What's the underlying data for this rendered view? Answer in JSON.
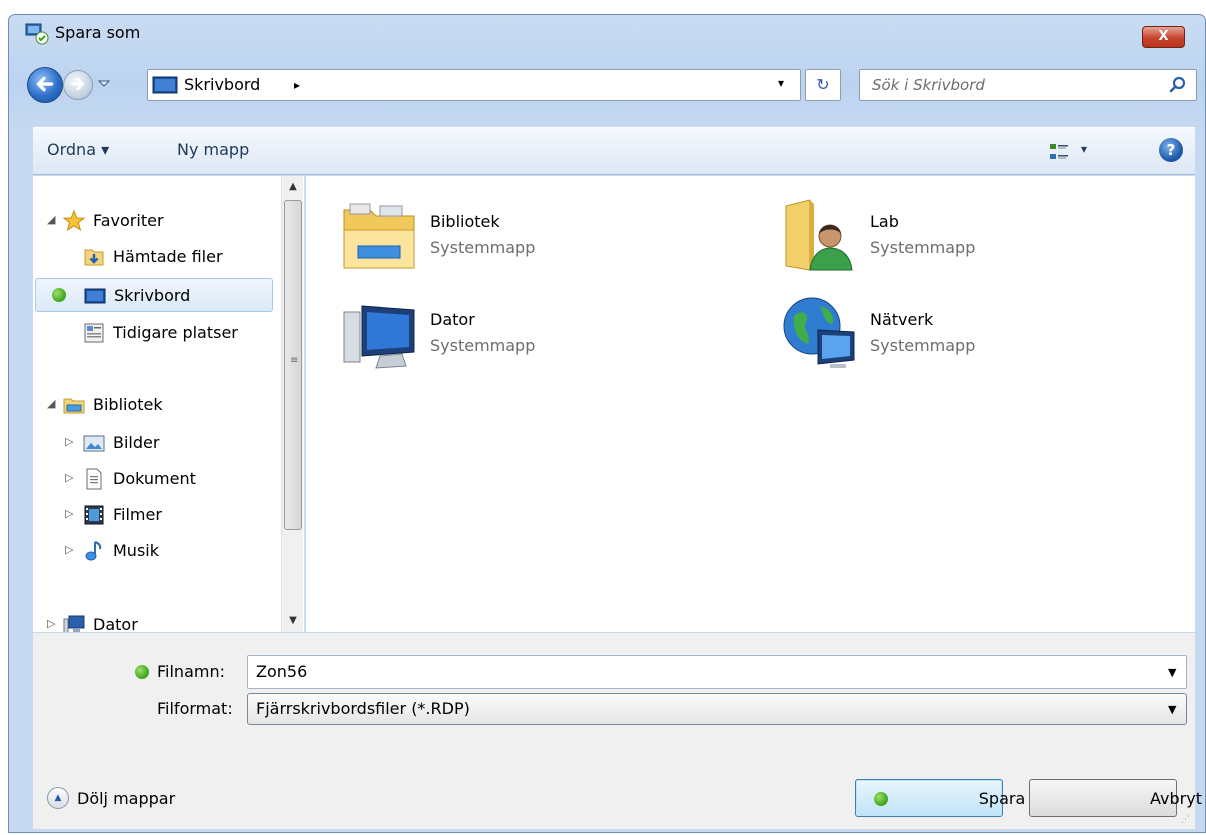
{
  "window": {
    "title": "Spara som",
    "close_label": "X"
  },
  "address": {
    "location": "Skrivbord",
    "breadcrumb_arrow": "▸",
    "dropdown_glyph": "▾",
    "refresh_glyph": "↻",
    "search_placeholder": "Sök i Skrivbord"
  },
  "toolbar": {
    "organize_label": "Ordna ▾",
    "new_folder_label": "Ny mapp",
    "view_dropdown_glyph": "▾",
    "help_glyph": "?"
  },
  "nav": {
    "favorites": {
      "label": "Favoriter",
      "items": [
        "Hämtade filer",
        "Skrivbord",
        "Tidigare platser"
      ],
      "selected": "Skrivbord"
    },
    "libraries": {
      "label": "Bibliotek",
      "items": [
        "Bilder",
        "Dokument",
        "Filmer",
        "Musik"
      ]
    },
    "computer": {
      "label": "Dator"
    },
    "expand_glyph": "◢",
    "collapsed_glyph": "▷",
    "scroll_up": "▲",
    "scroll_down": "▼",
    "grip": "≡"
  },
  "content": {
    "items": [
      {
        "name": "Bibliotek",
        "type": "Systemmapp",
        "icon": "libraries-folder-icon"
      },
      {
        "name": "Lab",
        "type": "Systemmapp",
        "icon": "user-folder-icon"
      },
      {
        "name": "Dator",
        "type": "Systemmapp",
        "icon": "computer-icon"
      },
      {
        "name": "Nätverk",
        "type": "Systemmapp",
        "icon": "network-icon"
      }
    ]
  },
  "bottom": {
    "filename_label": "Filnamn:",
    "filename_value": "Zon56",
    "filetype_label": "Filformat:",
    "filetype_value": "Fjärrskrivbordsfiler (*.RDP)",
    "combo_glyph": "▼",
    "hide_folders_label": "Dölj mappar",
    "hide_glyph": "▲",
    "save_label": "Spara",
    "cancel_label": "Avbryt",
    "resize_grip": "⋰"
  },
  "colors": {
    "accent": "#3aa31c",
    "window_frame": "#c6d9f1",
    "selection": "#dbeaf8"
  }
}
